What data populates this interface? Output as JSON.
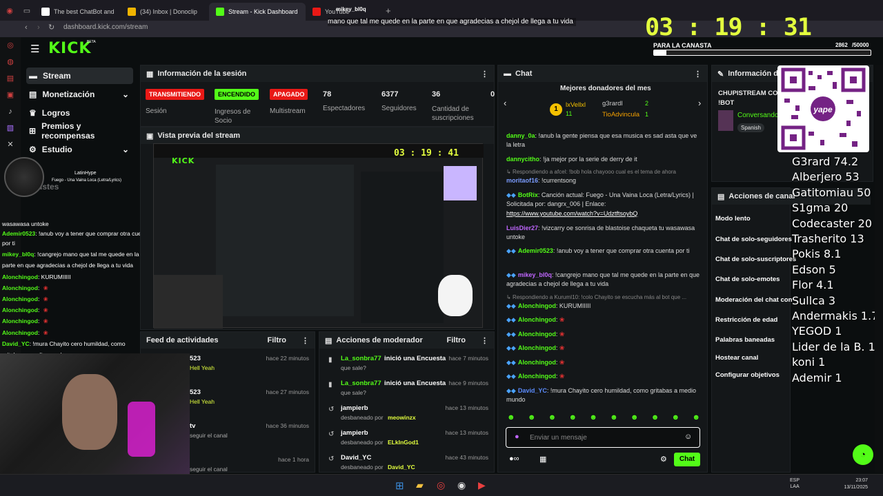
{
  "browser": {
    "tabs": [
      {
        "label": "The best ChatBot and"
      },
      {
        "label": "(34) Inbox | Donoclip"
      },
      {
        "label": "Stream - Kick Dashboard"
      },
      {
        "label": "YouTube"
      }
    ],
    "url": "dashboard.kick.com/stream"
  },
  "header": {
    "logo": "KICK",
    "beta": "BETA"
  },
  "nav": [
    {
      "label": "Stream"
    },
    {
      "label": "Monetización"
    },
    {
      "label": "Logros"
    },
    {
      "label": "Premios y recompensas"
    },
    {
      "label": "Estudio"
    },
    {
      "label": "Ajustes"
    }
  ],
  "tts_banner": {
    "user": "mikey_bl0q",
    "text": "mano que tal me quede en la parte en que agradecias a chejol de llega a tu vida"
  },
  "timer": {
    "h": "03",
    "m": "19",
    "s": "31"
  },
  "goal": {
    "label": "PARA LA CANASTA",
    "current": "2862",
    "target": "/50000"
  },
  "session": {
    "title": "Información de la sesión",
    "status_live": "TRANSMITIENDO",
    "status_live_label": "Sesión",
    "income": "ENCENDIDO",
    "income_label": "Ingresos de Socio",
    "multistream": "APAGADO",
    "multistream_label": "Multistream",
    "viewers": "78",
    "viewers_label": "Espectadores",
    "followers": "6377",
    "followers_label": "Seguidores",
    "subs": "36",
    "subs_label": "Cantidad de suscripciones",
    "extra": "0"
  },
  "preview": {
    "title": "Vista previa del stream"
  },
  "activity": {
    "title": "Feed de actividades",
    "filter": "Filtro",
    "items": [
      {
        "user": "523",
        "sub": "Hell Yeah",
        "time": "hace 22 minutos"
      },
      {
        "user": "523",
        "sub": "Hell Yeah",
        "time": "hace 27 minutos"
      },
      {
        "user": "tv",
        "sub": "seguir el canal",
        "time": "hace 36 minutos"
      },
      {
        "user": "",
        "sub": "seguir el canal",
        "time": "hace 1 hora"
      }
    ]
  },
  "mod": {
    "title": "Acciones de moderador",
    "filter": "Filtro",
    "items": [
      {
        "user": "La_sonbra77",
        "action": "inició una Encuesta",
        "sub": "que sale?",
        "time": "hace 7 minutos"
      },
      {
        "user": "La_sonbra77",
        "action": "inició una Encuesta",
        "sub": "que sale?",
        "time": "hace 9 minutos"
      },
      {
        "user": "jampierb",
        "action": "",
        "sub": "desbaneado por",
        "by": "meowinzx",
        "time": "hace 13 minutos"
      },
      {
        "user": "jampierb",
        "action": "",
        "sub": "desbaneado por",
        "by": "ELkInGod1",
        "time": "hace 13 minutos"
      },
      {
        "user": "David_YC",
        "action": "",
        "sub": "desbaneado por",
        "by": "David_YC",
        "time": "hace 43 minutos"
      }
    ]
  },
  "chat": {
    "title": "Chat",
    "donors_title": "Mejores donadores del mes",
    "donor1": "lxVellxl",
    "donor1_amt": "11",
    "donor2": "g3rardl",
    "donor2_amt": "2",
    "donor3": "TioAdvincula",
    "donor3_amt": "1",
    "lines": [
      {
        "user": "danny_0a",
        "text": "!anub la gente piensa que esa musica es sad asta que ve la letra",
        "color": "#53fc18"
      },
      {
        "user": "dannycitho",
        "text": "!ja mejor por la serie de derry de it",
        "color": "#53fc18"
      },
      {
        "reply": "Respondiendo a afcel: !bob hola chayooo cual es el tema de ahora"
      },
      {
        "user": "moritaof16",
        "text": "!currentsong",
        "color": "#7b9cff"
      },
      {
        "user": "BotRix",
        "text": "Canción actual: Fuego - Una Vaina Loca (Letra/Lyrics) | Solicitada por: dangrx_006 | Enlace:",
        "color": "#53fc18"
      },
      {
        "link": "https://www.youtube.com/watch?v=UdztftsoybQ"
      },
      {
        "user": "LuisDier27",
        "text": "!vizcarry oe sonrisa de blastoise chaqueta tu wasawasa untoke",
        "color": "#c066ff"
      },
      {
        "user": "Ademir0523",
        "text": "!anub voy a tener que comprar otra cuenta por ti",
        "color": "#53fc18"
      },
      {
        "user": "mikey_bl0q",
        "text": "!cangrejo mano que tal me quede en la parte en que agradecias a chejol de llega a tu vida",
        "color": "#c066ff"
      },
      {
        "reply": "Respondiendo a KurumI10: !colo Chayito se escucha más al bot que ..."
      },
      {
        "user": "Alonchingod",
        "text": "KURUMIIIII",
        "color": "#53fc18"
      },
      {
        "user": "Alonchingod",
        "text": "",
        "color": "#53fc18"
      },
      {
        "user": "Alonchingod",
        "text": "",
        "color": "#53fc18"
      },
      {
        "user": "Alonchingod",
        "text": "",
        "color": "#53fc18"
      },
      {
        "user": "Alonchingod",
        "text": "",
        "color": "#53fc18"
      },
      {
        "user": "Alonchingod",
        "text": "",
        "color": "#53fc18"
      },
      {
        "user": "David_YC",
        "text": "!mura Chayito cero humildad, como gritabas a medio mundo",
        "color": "#5b8cff"
      }
    ],
    "placeholder": "Enviar un mensaje",
    "send": "Chat"
  },
  "info": {
    "title": "Información del s",
    "stream_title": "CHUPISTREAM CO",
    "stream_title2": "!BOT",
    "category": "Conversando",
    "tag": "Spanish"
  },
  "actions": {
    "title": "Acciones de canal",
    "items": [
      "Modo lento",
      "Chat de solo-seguidores",
      "Chat de solo-suscriptores",
      "Chat de solo-emotes",
      "Moderación del chat con",
      "Restricción de edad",
      "Palabras baneadas",
      "Hostear canal",
      "Configurar objetivos"
    ]
  },
  "ranking": [
    "G3rard 74.2",
    "Alberjero 53",
    "Gatitomiau 50",
    "S1gma 20",
    "Codecaster 20",
    "Trasherito 13",
    "Pokis 8.1",
    "Edson 5",
    "Flor 4.1",
    "Sullca 3",
    "Andermakis 1.7",
    "YEGOD 1",
    "Lider de la B. 1",
    "koni 1",
    "Ademir 1"
  ],
  "overlay": {
    "song_artist": "LatinHype",
    "song_title": "Fuego - Una Vaina Loca (Letra/Lyrics)",
    "lines": [
      {
        "user": "",
        "text": "wasawasa untoke"
      },
      {
        "user": "Ademir0523",
        "text": "!anub voy a tener que comprar otra cuenta"
      },
      {
        "user": "",
        "text": "por ti"
      },
      {
        "user": "mikey_bl0q",
        "text": "!cangrejo mano que tal me quede en la"
      },
      {
        "user": "",
        "text": "parte en que agradecias a chejol de llega a tu vida"
      },
      {
        "user": "Alonchingod",
        "text": "KURUMIIIII"
      },
      {
        "user": "Alonchingod",
        "text": ""
      },
      {
        "user": "Alonchingod",
        "text": ""
      },
      {
        "user": "Alonchingod",
        "text": ""
      },
      {
        "user": "Alonchingod",
        "text": ""
      },
      {
        "user": "Alonchingod",
        "text": ""
      },
      {
        "user": "David_YC",
        "text": "!mura Chayito cero humildad, como"
      },
      {
        "user": "",
        "text": "gritabas a medio mundo"
      }
    ]
  },
  "taskbar": {
    "lang": "ESP",
    "lang2": "LAA",
    "time": "23:07",
    "date": "13/11/2025"
  },
  "colors": {
    "accent": "#53fc18",
    "live": "#e91916",
    "bg": "#0b0e0f"
  }
}
